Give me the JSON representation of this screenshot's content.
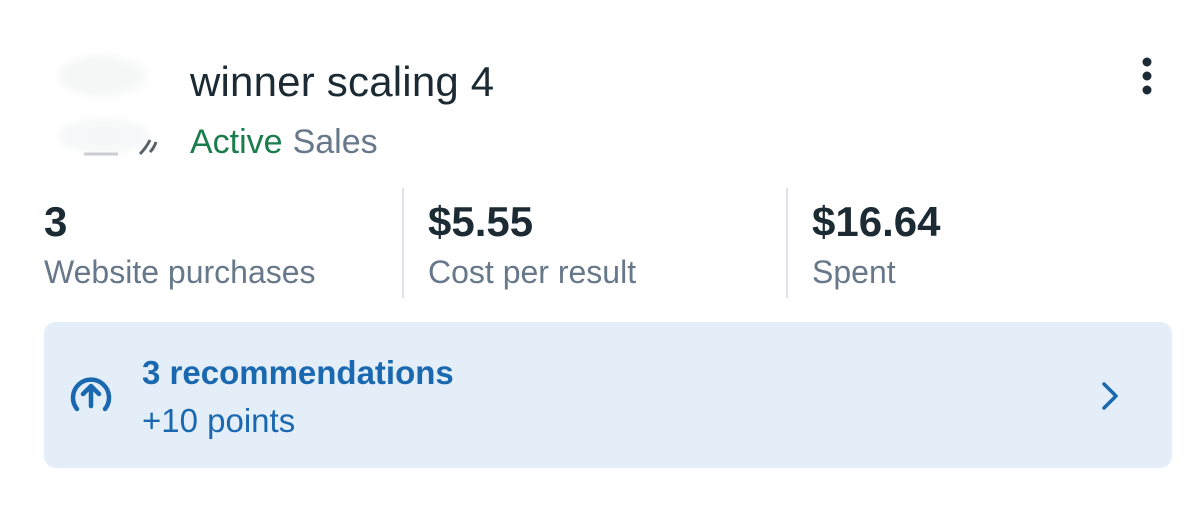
{
  "campaign": {
    "title": "winner scaling 4",
    "status": "Active",
    "objective": "Sales"
  },
  "metrics": [
    {
      "value": "3",
      "label": "Website purchases"
    },
    {
      "value": "$5.55",
      "label": "Cost per result"
    },
    {
      "value": "$16.64",
      "label": "Spent"
    }
  ],
  "recommendations": {
    "title": "3 recommendations",
    "points": "+10 points"
  },
  "icons": {
    "more": "more-vertical-icon",
    "recommendation": "arrow-up-circle-icon",
    "chevron": "chevron-right-icon"
  },
  "colors": {
    "active": "#1b7c4c",
    "accent": "#1a68b0",
    "reco_background": "#e3eef9",
    "muted_text": "#67788a",
    "primary_text": "#1c2b33"
  }
}
